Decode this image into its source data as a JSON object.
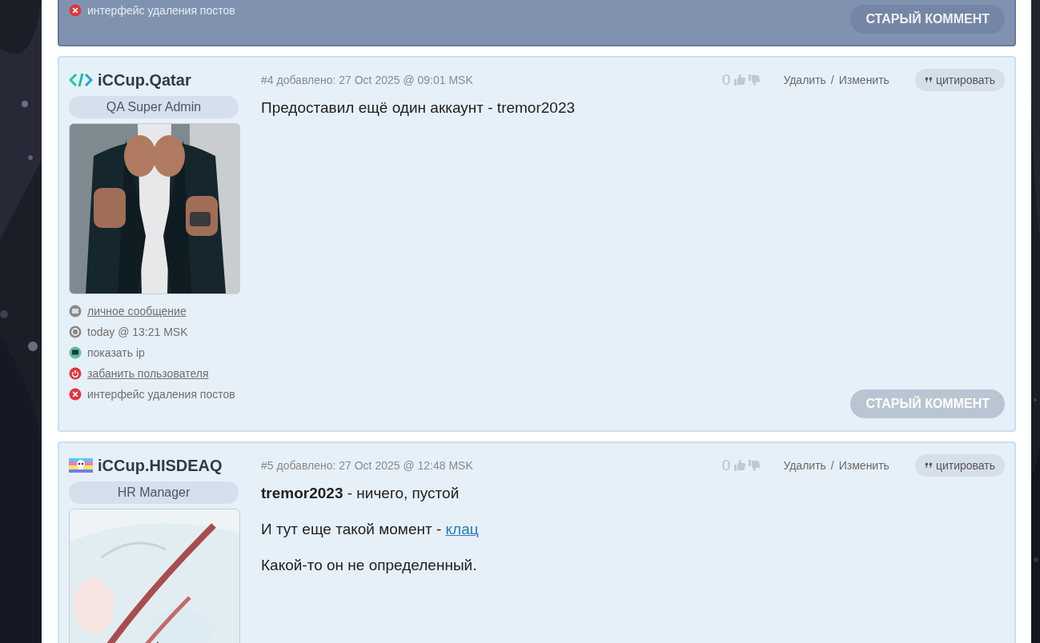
{
  "previous_post": {
    "highlighted": true,
    "info": [
      {
        "kind": "delete",
        "text": "интерфейс удаления постов",
        "link": false
      }
    ],
    "old_button": "СТАРЫЙ КОММЕНТ"
  },
  "posts": [
    {
      "highlighted": false,
      "badge": {
        "kind": "code"
      },
      "author": "iCCup.Qatar",
      "role": "QA Super Admin",
      "avatar": {
        "kind": "picture"
      },
      "number": "#4",
      "added": "добавлено: 27 Oct 2025 @ 09:01 MSK",
      "votes": "0",
      "delete": "Удалить",
      "separator": "/",
      "edit": "Изменить",
      "quote": "цитировать",
      "body": [
        {
          "text": "Предоставил ещё один аккаунт - tremor2023"
        }
      ],
      "info": [
        {
          "kind": "mail",
          "text": "личное сообщение",
          "link": true
        },
        {
          "kind": "clock",
          "text": "today @ 13:21 MSK",
          "link": false
        },
        {
          "kind": "monitor",
          "text": "показать ip",
          "link": false
        },
        {
          "kind": "power",
          "text": "забанить пользователя",
          "link": true
        },
        {
          "kind": "delete",
          "text": "интерфейс удаления постов",
          "link": false
        }
      ],
      "old_button": "СТАРЫЙ КОММЕНТ"
    },
    {
      "highlighted": false,
      "badge": {
        "kind": "flag"
      },
      "author": "iCCup.HISDEAQ",
      "role": "HR Manager",
      "avatar": {
        "kind": "picture"
      },
      "number": "#5",
      "added": "добавлено: 27 Oct 2025 @ 12:48 MSK",
      "votes": "0",
      "delete": "Удалить",
      "separator": "/",
      "edit": "Изменить",
      "quote": "цитировать",
      "body": [
        {
          "text": "**tremor2023** - ничего, пустой"
        },
        {
          "text": "И тут еще такой момент - ",
          "link": "клац"
        },
        {
          "text": "Какой-то он не определенный."
        }
      ]
    }
  ]
}
